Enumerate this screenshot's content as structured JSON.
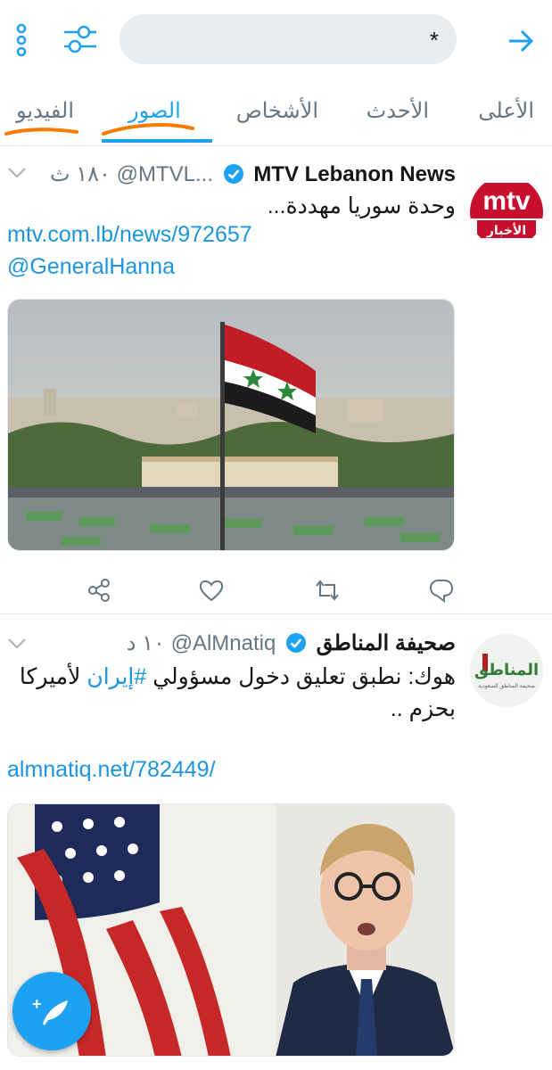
{
  "search": {
    "query": "*"
  },
  "tabs": [
    {
      "label": "الأعلى",
      "active": false
    },
    {
      "label": "الأحدث",
      "active": false
    },
    {
      "label": "الأشخاص",
      "active": false
    },
    {
      "label": "الصور",
      "active": true
    },
    {
      "label": "الفيديو",
      "active": false
    }
  ],
  "tweets": [
    {
      "name": "MTV Lebanon News",
      "handle": "@MTVL...",
      "time": "١٨٠ ث",
      "verified": true,
      "avatar_text": "mtv",
      "avatar_sub": "الأخبار",
      "text": "وحدة سوريا مهددة...",
      "links": [
        "mtv.com.lb/news/972657",
        "@GeneralHanna"
      ],
      "media": "syrian-flag-over-city"
    },
    {
      "name": "صحيفة المناطق",
      "handle": "@AlMnatiq",
      "time": "١٠ د",
      "verified": true,
      "avatar_text": "المناطق",
      "avatar_sub": "صحيفة المناطق السعودية",
      "text_before": "هوك: نطبق تعليق دخول مسؤولي ",
      "hashtag": "#إيران",
      "text_after": " لأميركا بحزم ..",
      "links": [
        "almnatiq.net/782449/"
      ],
      "media": "man-with-us-flag"
    }
  ],
  "colors": {
    "accent": "#1da1f2",
    "text": "#14171a",
    "muted": "#657786",
    "scribble": "#f57c00"
  },
  "icons": [
    "more-vertical-icon",
    "filter-sliders-icon",
    "arrow-right-icon",
    "chevron-down-icon",
    "verified-badge-icon",
    "share-icon",
    "like-icon",
    "retweet-icon",
    "reply-icon",
    "compose-tweet-icon"
  ]
}
